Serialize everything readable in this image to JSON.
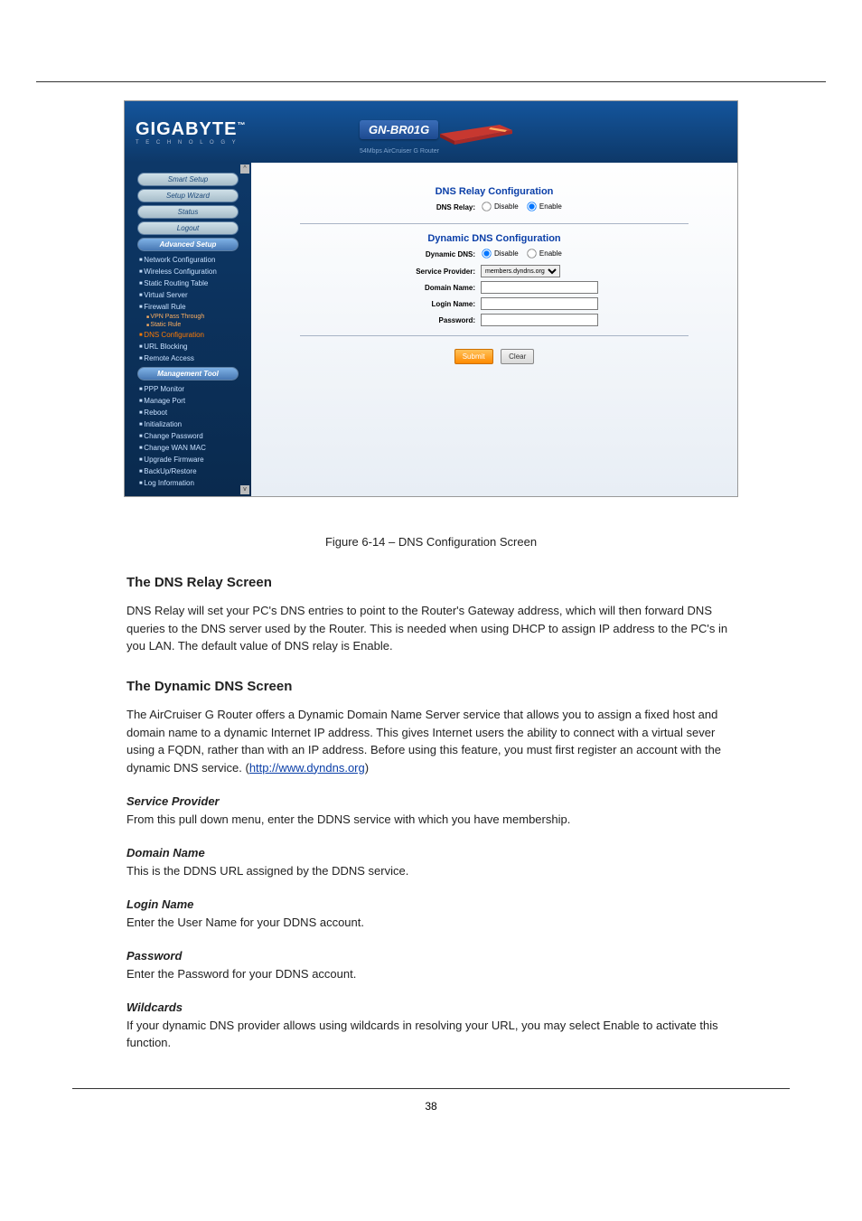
{
  "page_header_model": "GN-BR01G",
  "page_header_sub": "54Mbps AirCruiser G Router",
  "logo": "GIGABYTE",
  "logo_sub": "T E C H N O L O G Y",
  "sidebar": {
    "top_buttons": [
      "Smart Setup",
      "Setup Wizard",
      "Status",
      "Logout"
    ],
    "adv_header": "Advanced Setup",
    "adv": [
      "Network Configuration",
      "Wireless Configuration",
      "Static Routing Table",
      "Virtual Server",
      "Firewall Rule"
    ],
    "adv_sub": [
      "VPN Pass Through",
      "Static Rule"
    ],
    "adv2": [
      "DNS Configuration",
      "URL Blocking",
      "Remote Access"
    ],
    "mgmt_header": "Management Tool",
    "mgmt": [
      "PPP Monitor",
      "Manage Port",
      "Reboot",
      "Initialization",
      "Change Password",
      "Change WAN MAC",
      "Upgrade Firmware",
      "BackUp/Restore",
      "Log Information"
    ]
  },
  "content": {
    "relay_title": "DNS Relay Configuration",
    "relay_label": "DNS Relay:",
    "disable": "Disable",
    "enable": "Enable",
    "ddns_title": "Dynamic DNS Configuration",
    "ddns_label": "Dynamic DNS:",
    "provider_label": "Service Provider:",
    "provider_value": "members.dyndns.org",
    "domain_label": "Domain Name:",
    "login_label": "Login Name:",
    "password_label": "Password:",
    "submit": "Submit",
    "clear": "Clear"
  },
  "doc": {
    "fig_caption": "Figure 6-14 – DNS Configuration Screen",
    "h_relay": "The DNS Relay Screen",
    "p_relay": "DNS Relay will set your PC's DNS entries to point to the Router's Gateway address, which will then forward DNS queries to the DNS server used by the Router. This is needed when using DHCP to assign IP address to the PC's in you LAN. The default value of DNS relay is Enable.",
    "h_ddns": "The Dynamic DNS Screen",
    "p_ddns_1": "The AirCruiser G Router offers a Dynamic Domain Name Server service that allows you to assign a fixed host and domain name to a dynamic Internet IP address. This gives Internet users the ability to connect with a virtual sever using a FQDN, rather than with an IP address. Before using this feature, you must first register an account with the dynamic DNS service. ",
    "link_text": "http://www.dyndns.org",
    "link_href": "http://www.dyndns.org",
    "p_ddns_2": "",
    "f_sp": "Service Provider",
    "f_sp_t": "From this pull down menu, enter the DDNS service with which you have membership.",
    "f_dn": "Domain Name",
    "f_dn_t": "This is the DDNS URL assigned by the DDNS service.",
    "f_ln": "Login Name",
    "f_ln_t": "Enter the User Name for your DDNS account.",
    "f_pw": "Password",
    "f_pw_t": "Enter the Password for your DDNS account.",
    "f_wc": "Wildcards",
    "f_wc_t": "If your dynamic DNS provider allows using wildcards in resolving your URL, you may select Enable to activate this function.",
    "page_num": "38"
  }
}
